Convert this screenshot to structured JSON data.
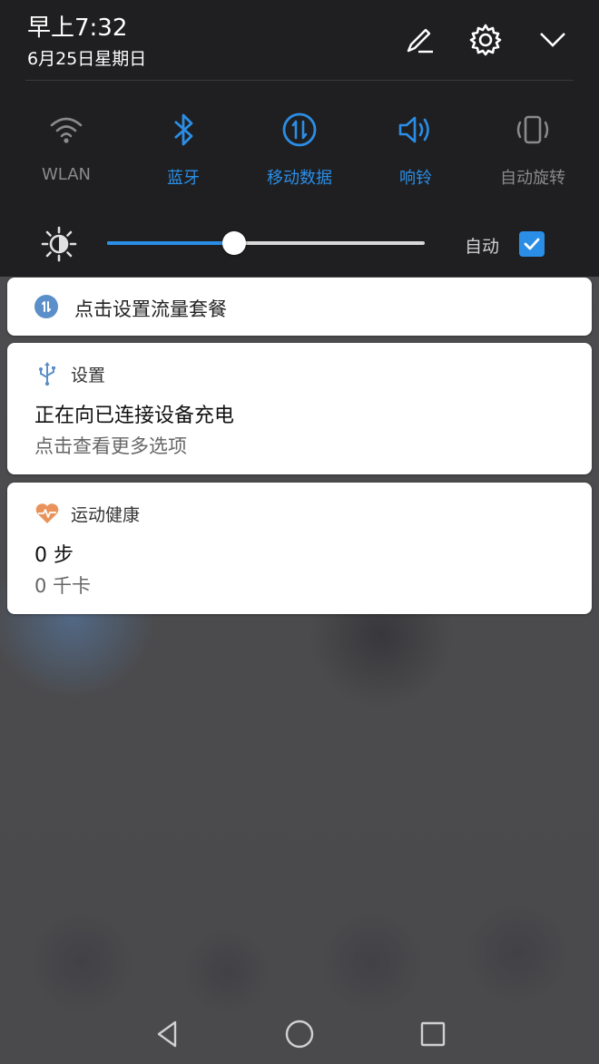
{
  "status": {
    "time": "早上7:32",
    "date": "6月25日星期日"
  },
  "header_icons": [
    {
      "name": "edit-icon"
    },
    {
      "name": "settings-icon"
    },
    {
      "name": "collapse-icon"
    }
  ],
  "quick_settings": {
    "tiles": [
      {
        "id": "wlan",
        "label": "WLAN",
        "icon": "wifi-icon",
        "active": false
      },
      {
        "id": "bluetooth",
        "label": "蓝牙",
        "icon": "bluetooth-icon",
        "active": true
      },
      {
        "id": "mobile-data",
        "label": "移动数据",
        "icon": "mobile-data-icon",
        "active": true
      },
      {
        "id": "ringer",
        "label": "响铃",
        "icon": "volume-icon",
        "active": true
      },
      {
        "id": "auto-rotate",
        "label": "自动旋转",
        "icon": "rotate-icon",
        "active": false
      }
    ],
    "brightness": {
      "level": 0.4,
      "auto_label": "自动",
      "auto_checked": true
    }
  },
  "notifications": [
    {
      "icon": "mobile-data-icon",
      "text": "点击设置流量套餐"
    },
    {
      "app": "设置",
      "icon": "usb-icon",
      "title": "正在向已连接设备充电",
      "subtitle": "点击查看更多选项"
    },
    {
      "app": "运动健康",
      "icon": "heart-icon",
      "title": "0 步",
      "subtitle": "0 千卡"
    }
  ],
  "nav": {
    "buttons": [
      "back",
      "home",
      "recents"
    ]
  },
  "colors": {
    "accent": "#2b8ee6",
    "panel": "#1f1f21",
    "health": "#e9935a"
  }
}
